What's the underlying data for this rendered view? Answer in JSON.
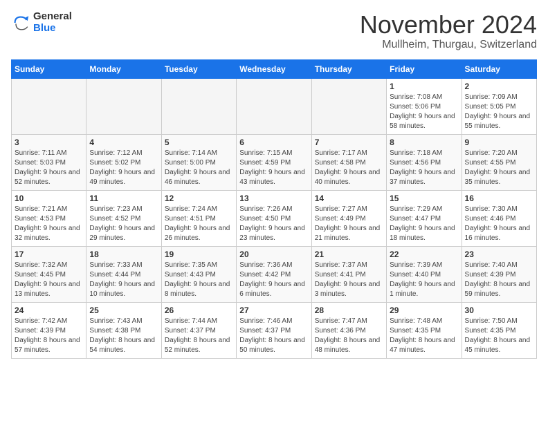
{
  "logo": {
    "general": "General",
    "blue": "Blue"
  },
  "title": {
    "month": "November 2024",
    "location": "Mullheim, Thurgau, Switzerland"
  },
  "weekdays": [
    "Sunday",
    "Monday",
    "Tuesday",
    "Wednesday",
    "Thursday",
    "Friday",
    "Saturday"
  ],
  "weeks": [
    [
      {
        "day": "",
        "info": ""
      },
      {
        "day": "",
        "info": ""
      },
      {
        "day": "",
        "info": ""
      },
      {
        "day": "",
        "info": ""
      },
      {
        "day": "",
        "info": ""
      },
      {
        "day": "1",
        "info": "Sunrise: 7:08 AM\nSunset: 5:06 PM\nDaylight: 9 hours and 58 minutes."
      },
      {
        "day": "2",
        "info": "Sunrise: 7:09 AM\nSunset: 5:05 PM\nDaylight: 9 hours and 55 minutes."
      }
    ],
    [
      {
        "day": "3",
        "info": "Sunrise: 7:11 AM\nSunset: 5:03 PM\nDaylight: 9 hours and 52 minutes."
      },
      {
        "day": "4",
        "info": "Sunrise: 7:12 AM\nSunset: 5:02 PM\nDaylight: 9 hours and 49 minutes."
      },
      {
        "day": "5",
        "info": "Sunrise: 7:14 AM\nSunset: 5:00 PM\nDaylight: 9 hours and 46 minutes."
      },
      {
        "day": "6",
        "info": "Sunrise: 7:15 AM\nSunset: 4:59 PM\nDaylight: 9 hours and 43 minutes."
      },
      {
        "day": "7",
        "info": "Sunrise: 7:17 AM\nSunset: 4:58 PM\nDaylight: 9 hours and 40 minutes."
      },
      {
        "day": "8",
        "info": "Sunrise: 7:18 AM\nSunset: 4:56 PM\nDaylight: 9 hours and 37 minutes."
      },
      {
        "day": "9",
        "info": "Sunrise: 7:20 AM\nSunset: 4:55 PM\nDaylight: 9 hours and 35 minutes."
      }
    ],
    [
      {
        "day": "10",
        "info": "Sunrise: 7:21 AM\nSunset: 4:53 PM\nDaylight: 9 hours and 32 minutes."
      },
      {
        "day": "11",
        "info": "Sunrise: 7:23 AM\nSunset: 4:52 PM\nDaylight: 9 hours and 29 minutes."
      },
      {
        "day": "12",
        "info": "Sunrise: 7:24 AM\nSunset: 4:51 PM\nDaylight: 9 hours and 26 minutes."
      },
      {
        "day": "13",
        "info": "Sunrise: 7:26 AM\nSunset: 4:50 PM\nDaylight: 9 hours and 23 minutes."
      },
      {
        "day": "14",
        "info": "Sunrise: 7:27 AM\nSunset: 4:49 PM\nDaylight: 9 hours and 21 minutes."
      },
      {
        "day": "15",
        "info": "Sunrise: 7:29 AM\nSunset: 4:47 PM\nDaylight: 9 hours and 18 minutes."
      },
      {
        "day": "16",
        "info": "Sunrise: 7:30 AM\nSunset: 4:46 PM\nDaylight: 9 hours and 16 minutes."
      }
    ],
    [
      {
        "day": "17",
        "info": "Sunrise: 7:32 AM\nSunset: 4:45 PM\nDaylight: 9 hours and 13 minutes."
      },
      {
        "day": "18",
        "info": "Sunrise: 7:33 AM\nSunset: 4:44 PM\nDaylight: 9 hours and 10 minutes."
      },
      {
        "day": "19",
        "info": "Sunrise: 7:35 AM\nSunset: 4:43 PM\nDaylight: 9 hours and 8 minutes."
      },
      {
        "day": "20",
        "info": "Sunrise: 7:36 AM\nSunset: 4:42 PM\nDaylight: 9 hours and 6 minutes."
      },
      {
        "day": "21",
        "info": "Sunrise: 7:37 AM\nSunset: 4:41 PM\nDaylight: 9 hours and 3 minutes."
      },
      {
        "day": "22",
        "info": "Sunrise: 7:39 AM\nSunset: 4:40 PM\nDaylight: 9 hours and 1 minute."
      },
      {
        "day": "23",
        "info": "Sunrise: 7:40 AM\nSunset: 4:39 PM\nDaylight: 8 hours and 59 minutes."
      }
    ],
    [
      {
        "day": "24",
        "info": "Sunrise: 7:42 AM\nSunset: 4:39 PM\nDaylight: 8 hours and 57 minutes."
      },
      {
        "day": "25",
        "info": "Sunrise: 7:43 AM\nSunset: 4:38 PM\nDaylight: 8 hours and 54 minutes."
      },
      {
        "day": "26",
        "info": "Sunrise: 7:44 AM\nSunset: 4:37 PM\nDaylight: 8 hours and 52 minutes."
      },
      {
        "day": "27",
        "info": "Sunrise: 7:46 AM\nSunset: 4:37 PM\nDaylight: 8 hours and 50 minutes."
      },
      {
        "day": "28",
        "info": "Sunrise: 7:47 AM\nSunset: 4:36 PM\nDaylight: 8 hours and 48 minutes."
      },
      {
        "day": "29",
        "info": "Sunrise: 7:48 AM\nSunset: 4:35 PM\nDaylight: 8 hours and 47 minutes."
      },
      {
        "day": "30",
        "info": "Sunrise: 7:50 AM\nSunset: 4:35 PM\nDaylight: 8 hours and 45 minutes."
      }
    ]
  ]
}
